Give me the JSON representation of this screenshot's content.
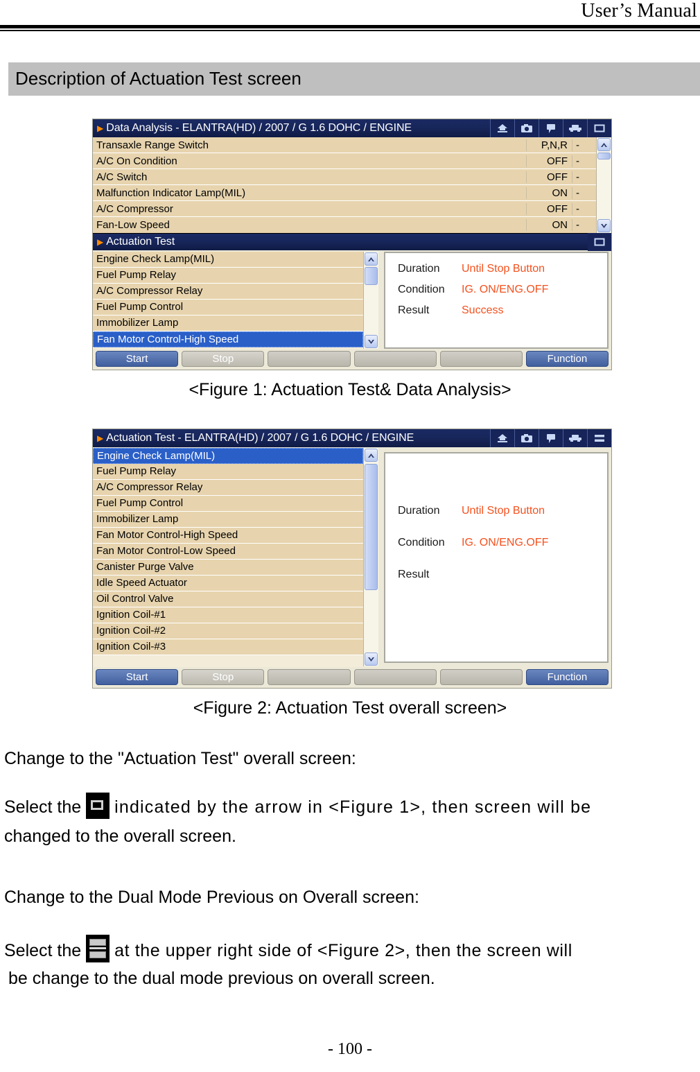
{
  "header": {
    "title": "User’s Manual"
  },
  "section": {
    "banner_title": "Description of Actuation Test screen"
  },
  "figure1": {
    "titlebar": {
      "title": "Data Analysis - ELANTRA(HD) / 2007 / G 1.6 DOHC / ENGINE",
      "icons": [
        "home-icon",
        "camera-icon",
        "flag-icon",
        "vehicle-icon",
        "window-mode-icon"
      ]
    },
    "data_analysis": {
      "rows": [
        {
          "name": "Transaxle Range Switch",
          "value": "P,N,R",
          "unit": "-"
        },
        {
          "name": "A/C On Condition",
          "value": "OFF",
          "unit": "-"
        },
        {
          "name": "A/C Switch",
          "value": "OFF",
          "unit": "-"
        },
        {
          "name": "Malfunction Indicator Lamp(MIL)",
          "value": "ON",
          "unit": "-"
        },
        {
          "name": "A/C Compressor",
          "value": "OFF",
          "unit": "-"
        },
        {
          "name": "Fan-Low Speed",
          "value": "ON",
          "unit": "-"
        }
      ]
    },
    "sub_titlebar": {
      "title": "Actuation Test",
      "icon": "window-mode-icon"
    },
    "actuation_items": [
      "Engine Check Lamp(MIL)",
      "Fuel Pump Relay",
      "A/C Compressor Relay",
      "Fuel Pump Control",
      "Immobilizer Lamp",
      "Fan Motor Control-High Speed"
    ],
    "selected_index": 5,
    "info": {
      "duration_label": "Duration",
      "duration_value": "Until Stop Button",
      "condition_label": "Condition",
      "condition_value": "IG. ON/ENG.OFF",
      "result_label": "Result",
      "result_value": "Success"
    },
    "buttons": [
      "Start",
      "Stop",
      "",
      "",
      "",
      "Function"
    ],
    "caption": "<Figure 1: Actuation Test& Data Analysis>"
  },
  "figure2": {
    "titlebar": {
      "title": "Actuation Test - ELANTRA(HD) / 2007 / G 1.6 DOHC / ENGINE",
      "icons": [
        "home-icon",
        "camera-icon",
        "flag-icon",
        "vehicle-icon",
        "dual-mode-icon"
      ]
    },
    "actuation_items": [
      "Engine Check Lamp(MIL)",
      "Fuel Pump Relay",
      "A/C Compressor Relay",
      "Fuel Pump Control",
      "Immobilizer Lamp",
      "Fan Motor Control-High Speed",
      "Fan Motor Control-Low Speed",
      "Canister Purge Valve",
      "Idle Speed Actuator",
      "Oil Control Valve",
      "Ignition Coil-#1",
      "Ignition Coil-#2",
      "Ignition Coil-#3"
    ],
    "selected_index": 0,
    "info": {
      "duration_label": "Duration",
      "duration_value": "Until Stop Button",
      "condition_label": "Condition",
      "condition_value": "IG. ON/ENG.OFF",
      "result_label": "Result",
      "result_value": ""
    },
    "buttons": [
      "Start",
      "Stop",
      "",
      "",
      "",
      "Function"
    ],
    "caption": "<Figure 2: Actuation Test overall screen>"
  },
  "body": {
    "para1_heading": "Change to the \"Actuation Test\" overall screen:",
    "para1_line1_a": "Select the",
    "para1_line1_b": "indicated by the arrow in <Figure 1>, then screen will be",
    "para1_line2": "changed to the overall screen.",
    "para2_heading": "Change to the Dual Mode Previous on Overall screen:",
    "para2_line1_a": "Select the",
    "para2_line1_b": "at the upper right side of <Figure 2>, then the screen will",
    "para2_line2": "be change to the dual mode previous on overall screen."
  },
  "footer": {
    "page_number": "- 100 -"
  },
  "colors": {
    "banner_bg": "#bfbfbf",
    "titlebar_blue": "#17265b",
    "row_beige": "#e7d4ae",
    "selection_blue": "#2a5fc8",
    "value_orange": "#f4511e",
    "button_blue": "#415f9e"
  }
}
